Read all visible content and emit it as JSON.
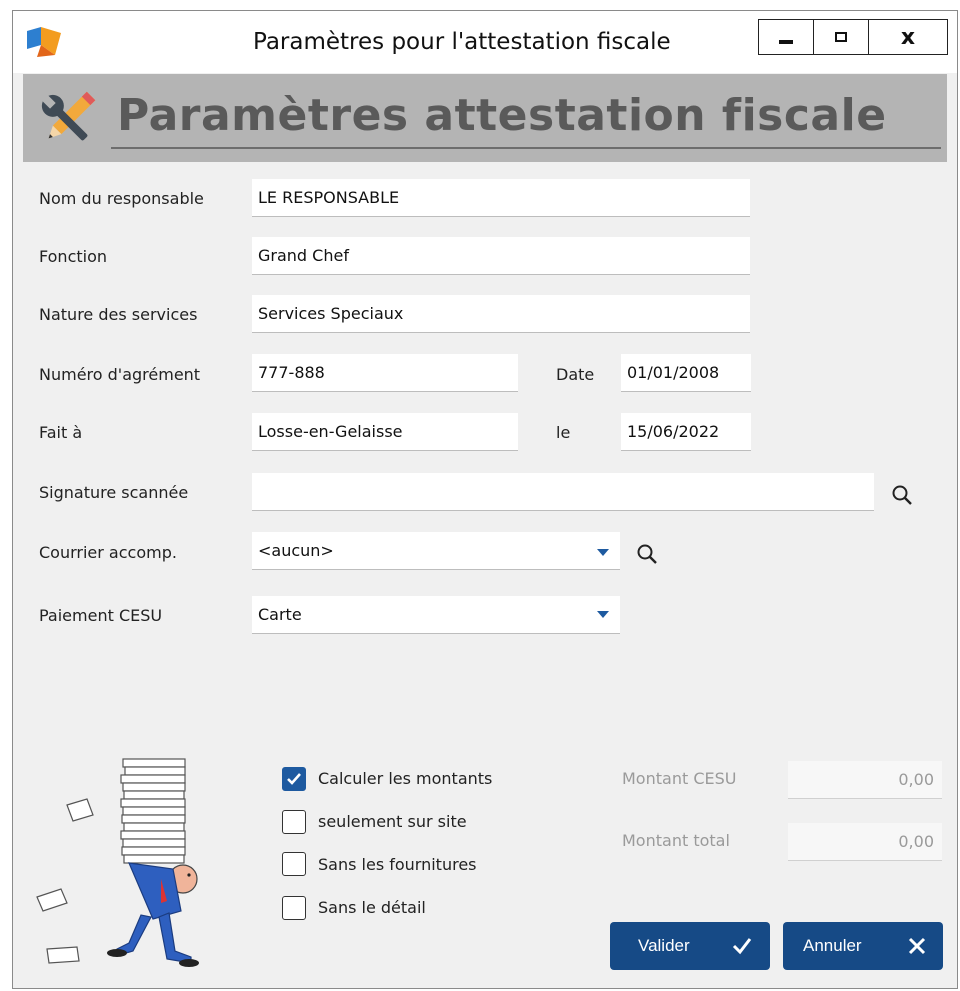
{
  "window": {
    "title": "Paramètres pour l'attestation fiscale",
    "controls": {
      "minimize": "minimize-icon",
      "maximize": "maximize-icon",
      "close": "close-icon"
    }
  },
  "banner": {
    "title": "Paramètres attestation fiscale",
    "icon": "tools-icon"
  },
  "form": {
    "nom_label": "Nom du responsable",
    "nom_value": "LE RESPONSABLE",
    "fonction_label": "Fonction",
    "fonction_value": "Grand Chef",
    "nature_label": "Nature des services",
    "nature_value": "Services Speciaux",
    "agrement_label": "Numéro d'agrément",
    "agrement_value": "777-888",
    "date_label": "Date",
    "date_value": "01/01/2008",
    "fait_label": "Fait à",
    "fait_value": "Losse-en-Gelaisse",
    "le_label": "le",
    "le_value": "15/06/2022",
    "signature_label": "Signature scannée",
    "signature_value": "",
    "courrier_label": "Courrier accomp.",
    "courrier_value": "<aucun>",
    "paiement_label": "Paiement CESU",
    "paiement_value": "Carte"
  },
  "options": [
    {
      "label": "Calculer les montants",
      "checked": true
    },
    {
      "label": "seulement sur site",
      "checked": false
    },
    {
      "label": "Sans les fournitures",
      "checked": false
    },
    {
      "label": "Sans le détail",
      "checked": false
    }
  ],
  "amounts": {
    "cesu_label": "Montant CESU",
    "cesu_value": "0,00",
    "total_label": "Montant total",
    "total_value": "0,00"
  },
  "buttons": {
    "valider": "Valider",
    "annuler": "Annuler"
  },
  "colors": {
    "accent": "#164a86",
    "banner": "#b4b4b4",
    "background": "#f0f0f0"
  }
}
